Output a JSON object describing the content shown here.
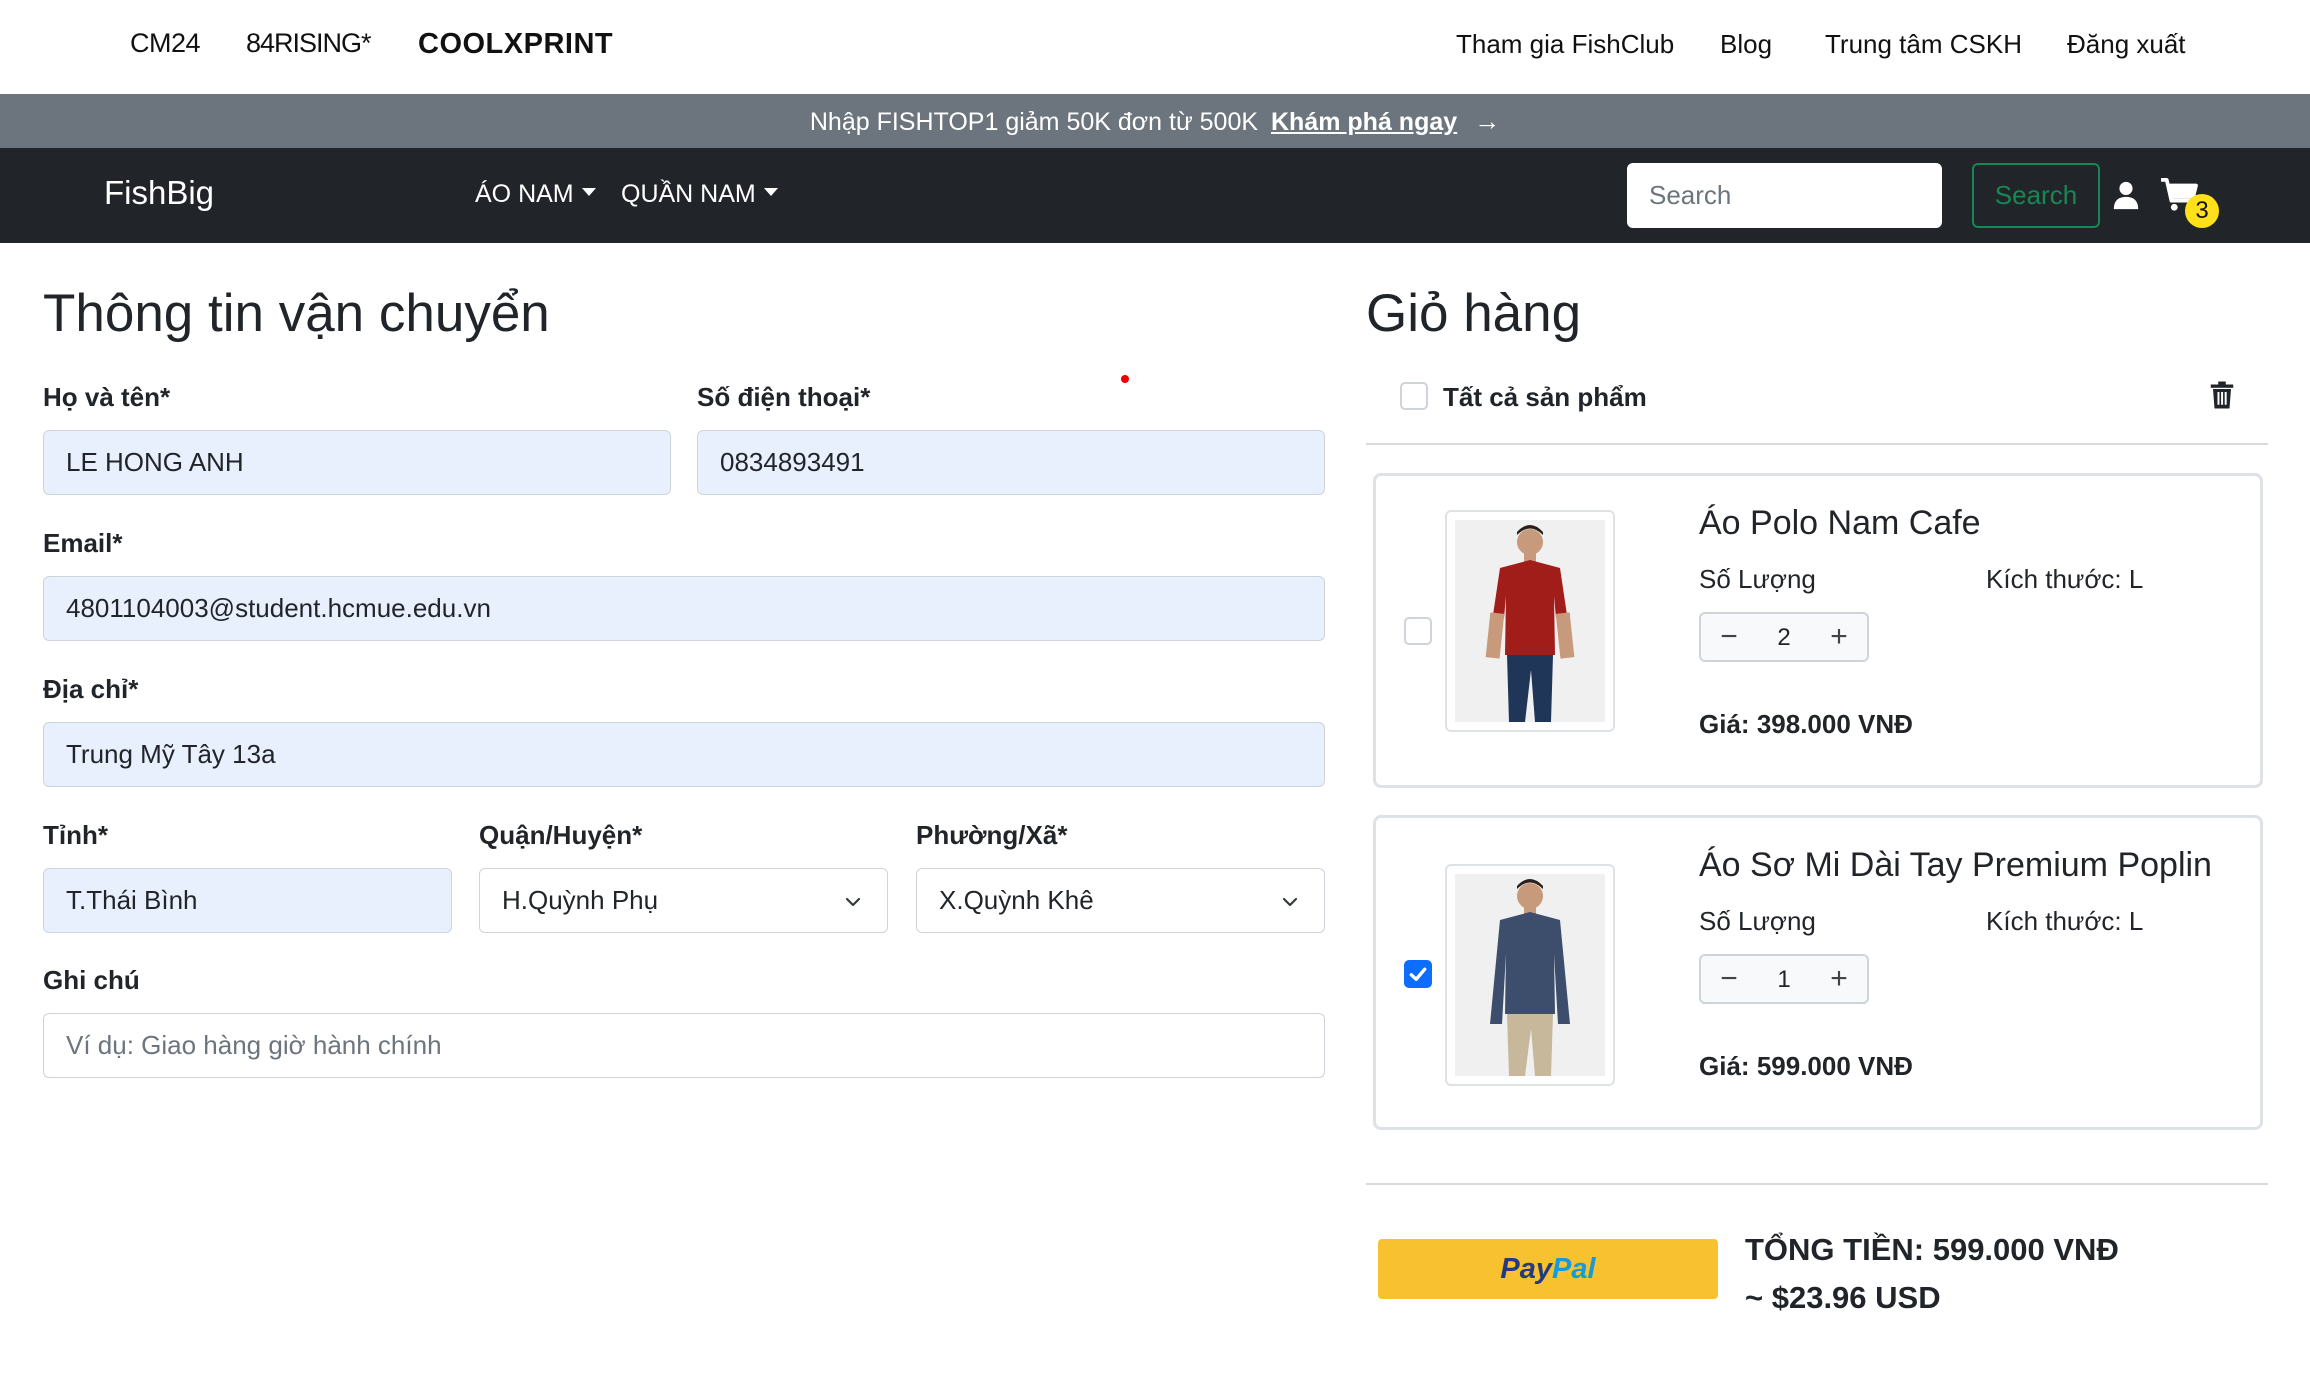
{
  "brands": [
    "CM24",
    "84RISING*",
    "COOLXPRINT"
  ],
  "top_links": [
    "Tham gia FishClub",
    "Blog",
    "Trung tâm CSKH",
    "Đăng xuất"
  ],
  "promo": {
    "text": "Nhập FISHTOP1 giảm 50K đơn từ 500K",
    "link": "Khám phá ngay",
    "arrow": "→"
  },
  "navbar": {
    "logo": "FishBig",
    "menu": [
      "ÁO NAM",
      "QUẦN NAM"
    ],
    "search_placeholder": "Search",
    "search_button": "Search",
    "cart_count": "3",
    "icons": [
      "user-icon",
      "cart-icon",
      "chevron-down-icon",
      "trash-icon",
      "check-icon"
    ]
  },
  "shipping": {
    "title": "Thông tin vận chuyển",
    "name_label": "Họ và tên*",
    "name_value": "LE HONG ANH",
    "phone_label": "Số điện thoại*",
    "phone_value": "0834893491",
    "email_label": "Email*",
    "email_value": "4801104003@student.hcmue.edu.vn",
    "address_label": "Địa chỉ*",
    "address_value": "Trung Mỹ Tây 13a",
    "province_label": "Tỉnh*",
    "province_value": "T.Thái Bình",
    "district_label": "Quận/Huyện*",
    "district_value": "H.Quỳnh Phụ",
    "ward_label": "Phường/Xã*",
    "ward_value": "X.Quỳnh Khê",
    "note_label": "Ghi chú",
    "note_placeholder": "Ví dụ: Giao hàng giờ hành chính"
  },
  "cart": {
    "title": "Giỏ hàng",
    "select_all": "Tất cả sản phẩm",
    "items": [
      {
        "name": "Áo Polo Nam Cafe",
        "qty_label": "Số Lượng",
        "size": "Kích thước: L",
        "qty": "2",
        "price_label": "Giá:",
        "price": "398.000 VNĐ",
        "checked": false,
        "shirt_color": "#a01d1a"
      },
      {
        "name": "Áo Sơ Mi Dài Tay Premium Poplin",
        "qty_label": "Số Lượng",
        "size": "Kích thước: L",
        "qty": "1",
        "price_label": "Giá:",
        "price": "599.000 VNĐ",
        "checked": true,
        "shirt_color": "#3d4e6c"
      }
    ],
    "paypal_a": "Pay",
    "paypal_b": "Pal",
    "total": "TỔNG TIỀN: 599.000 VNĐ",
    "total_usd": "~ $23.96 USD"
  },
  "colors": {
    "navbar": "#212529",
    "promo": "#6c757d",
    "accent_green": "#198754",
    "badge": "#ffe11b",
    "checkbox": "#0d6efd",
    "paypal": "#f7c12f"
  }
}
